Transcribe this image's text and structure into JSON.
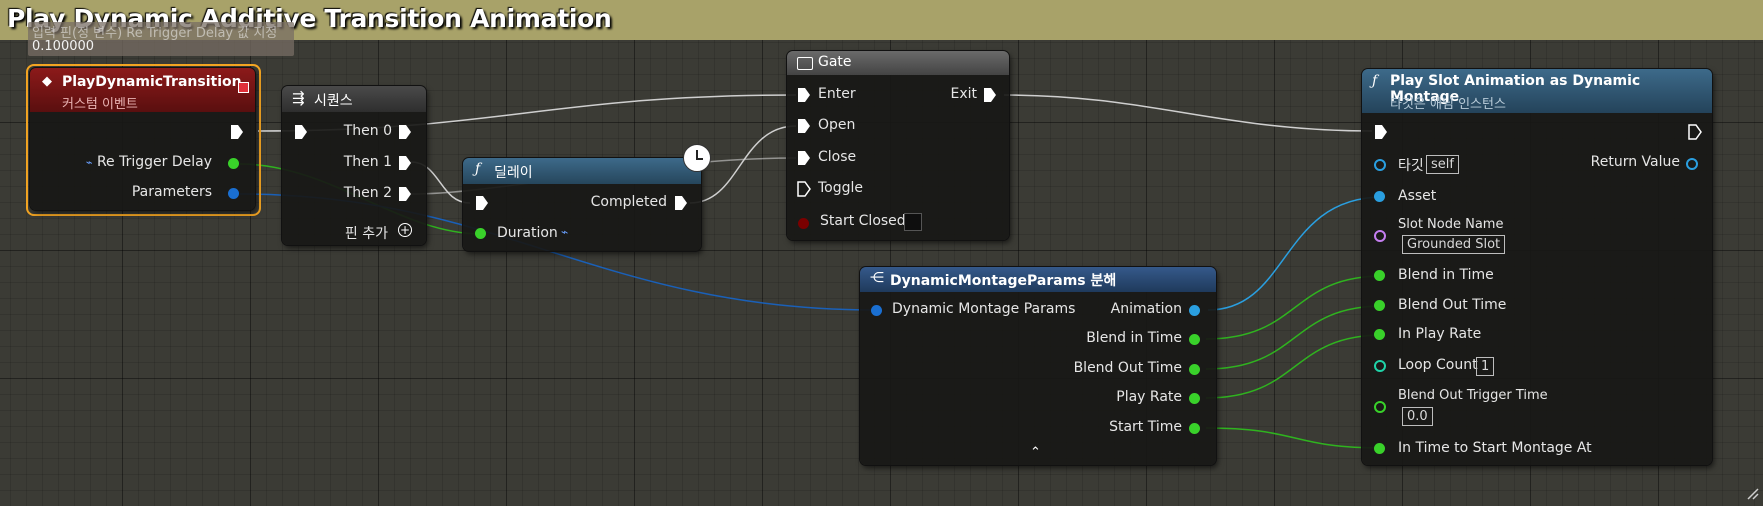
{
  "comment": {
    "title": "Play Dynamic Additive Transition Animation"
  },
  "tooltip": {
    "line1": "입력 핀(정 변수) Re Trigger Delay 값 지정",
    "line2": "0.100000"
  },
  "colors": {
    "exec": "#ffffff",
    "float": "#39d12a",
    "struct": "#1a6fd1",
    "object": "#2a9fe0",
    "name": "#c47ef0",
    "int": "#1fd3a8",
    "bool": "#8b0000",
    "event_header": "#7a1414",
    "function_header": "#2f5a78",
    "struct_header": "#25476a",
    "gate_header": "#555555"
  },
  "event_node": {
    "title": "PlayDynamicTransition",
    "subtitle": "커스텀 이벤트",
    "pins": [
      "Re Trigger Delay",
      "Parameters"
    ]
  },
  "sequence_node": {
    "title": "시퀀스",
    "outputs": [
      "Then 0",
      "Then 1",
      "Then 2"
    ],
    "add_pin": "핀 추가"
  },
  "delay_node": {
    "title": "딜레이",
    "output": "Completed",
    "input": "Duration"
  },
  "gate_node": {
    "title": "Gate",
    "inputs": [
      "Enter",
      "Open",
      "Close",
      "Toggle",
      "Start Closed"
    ],
    "output": "Exit"
  },
  "break_node": {
    "title": "DynamicMontageParams 분해",
    "input": "Dynamic Montage Params",
    "outputs": [
      "Animation",
      "Blend in Time",
      "Blend Out Time",
      "Play Rate",
      "Start Time"
    ]
  },
  "play_slot_node": {
    "title": "Play Slot Animation as Dynamic Montage",
    "subtitle": "타깃은 애님 인스턴스",
    "target_label": "타깃",
    "target_value": "self",
    "asset": "Asset",
    "slot_label": "Slot Node Name",
    "slot_value": "Grounded Slot",
    "blend_in": "Blend in Time",
    "blend_out": "Blend Out Time",
    "play_rate": "In Play Rate",
    "loop_label": "Loop Count",
    "loop_value": "1",
    "trigger_label": "Blend Out Trigger Time",
    "trigger_value": "0.0",
    "start_at": "In Time to Start Montage At",
    "return_value": "Return Value"
  }
}
